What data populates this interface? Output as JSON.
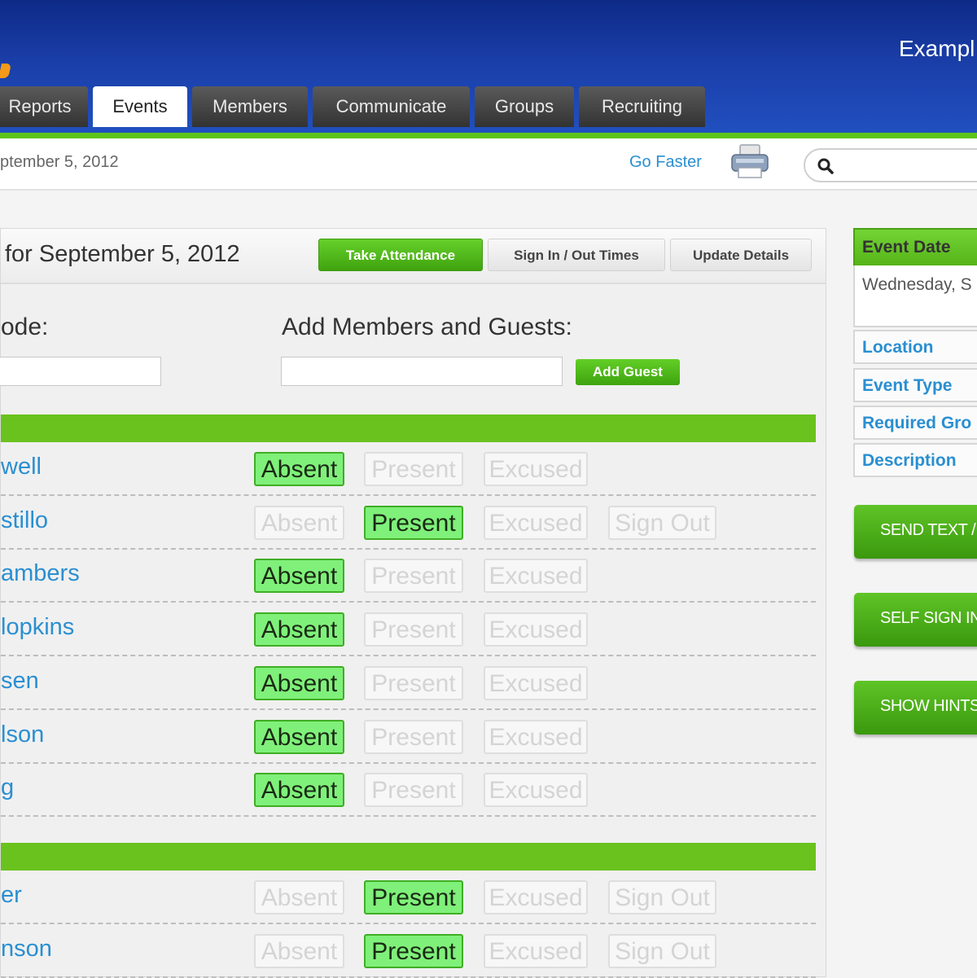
{
  "header": {
    "account_name": "Exampl",
    "tabs": [
      "Reports",
      "Events",
      "Members",
      "Communicate",
      "Groups",
      "Recruiting"
    ],
    "active_tab": "Events"
  },
  "subbar": {
    "breadcrumb": "ptember 5, 2012",
    "go_faster": "Go Faster"
  },
  "panel": {
    "title": "for September 5, 2012",
    "tabs": [
      "Take Attendance",
      "Sign In / Out Times",
      "Update Details"
    ],
    "active_tab": "Take Attendance",
    "code_label": "ode:",
    "add_label": "Add Members and Guests:",
    "add_guest_button": "Add Guest"
  },
  "attendance_buttons": {
    "absent": "Absent",
    "present": "Present",
    "excused": "Excused",
    "sign_out": "Sign Out"
  },
  "groups": [
    {
      "rows": [
        {
          "name": "well",
          "status": "absent"
        },
        {
          "name": "stillo",
          "status": "present"
        },
        {
          "name": "ambers",
          "status": "absent"
        },
        {
          "name": "lopkins",
          "status": "absent"
        },
        {
          "name": "sen",
          "status": "absent"
        },
        {
          "name": "lson",
          "status": "absent"
        },
        {
          "name": "g",
          "status": "absent"
        }
      ]
    },
    {
      "rows": [
        {
          "name": "er",
          "status": "present"
        },
        {
          "name": "nson",
          "status": "present"
        }
      ]
    }
  ],
  "sidebar": {
    "event_date_label": "Event Date",
    "event_date_value": "Wednesday, S",
    "links": [
      "Location",
      "Event Type",
      "Required Gro",
      "Description"
    ],
    "buttons": [
      "SEND TEXT /",
      "SELF SIGN IN",
      "SHOW HINTS"
    ]
  },
  "colors": {
    "header_blue": "#1a3ea8",
    "accent_green": "#5ec41a",
    "link_blue": "#2a8fd1",
    "selected_fill": "#7ff07a"
  }
}
